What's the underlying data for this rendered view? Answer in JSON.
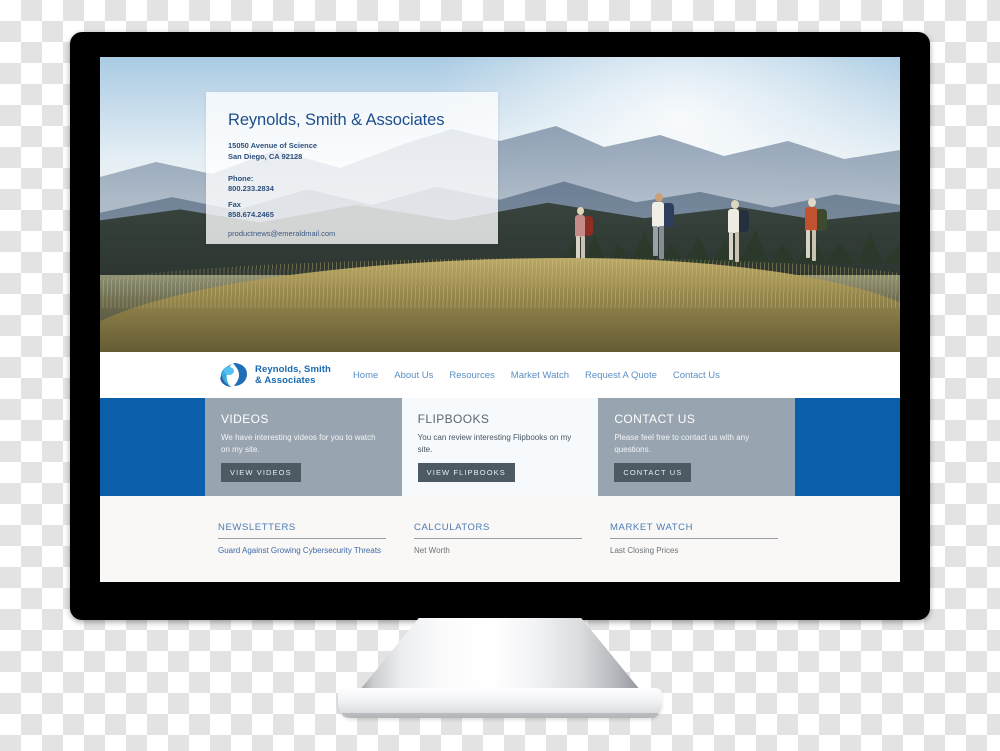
{
  "device": {
    "type": "desktop-monitor-mockup",
    "bezel_color": "#000000",
    "stand_color": "#f2f3f5"
  },
  "site": {
    "brand": {
      "name_line1": "Reynolds, Smith",
      "name_line2": "& Associates",
      "logo_icon": "swoosh-bird-logo-icon",
      "brand_color": "#1869b0"
    },
    "nav": {
      "items": [
        {
          "label": "Home"
        },
        {
          "label": "About Us"
        },
        {
          "label": "Resources"
        },
        {
          "label": "Market Watch"
        },
        {
          "label": "Request A Quote"
        },
        {
          "label": "Contact Us"
        }
      ]
    },
    "hero": {
      "image_description": "four hikers with backpacks walking along a grassy mountain ridge",
      "card": {
        "title": "Reynolds, Smith & Associates",
        "address_line1": "15050 Avenue of Science",
        "address_line2": "San Diego, CA 92128",
        "phone_label": "Phone:",
        "phone_value": "800.233.2834",
        "fax_label": "Fax",
        "fax_value": "858.674.2465",
        "email": "productnews@emeraldmail.com"
      }
    },
    "cards": {
      "accent_band_color": "#0b5ea9",
      "items": [
        {
          "title": "VIDEOS",
          "description": "We have interesting videos for you to watch on my site.",
          "button_label": "VIEW VIDEOS",
          "style": "gray"
        },
        {
          "title": "FLIPBOOKS",
          "description": "You can review interesting Flipbooks on my site.",
          "button_label": "VIEW FLIPBOOKS",
          "style": "light"
        },
        {
          "title": "CONTACT US",
          "description": "Please feel free to contact us with any questions.",
          "button_label": "CONTACT US",
          "style": "gray"
        }
      ]
    },
    "lower_sections": [
      {
        "title": "NEWSLETTERS",
        "link": "Guard Against Growing Cybersecurity Threats",
        "excerpt": ""
      },
      {
        "title": "CALCULATORS",
        "link": "Net Worth",
        "excerpt": ""
      },
      {
        "title": "MARKET WATCH",
        "link": "Last Closing Prices",
        "excerpt": ""
      }
    ]
  }
}
